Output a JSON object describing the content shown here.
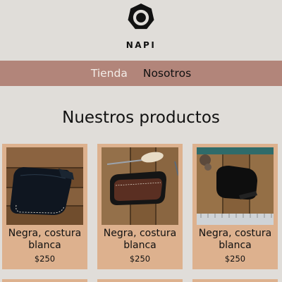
{
  "header": {
    "logo_icon": "heptagon-ring-logo",
    "brand": "NAPI"
  },
  "nav": {
    "items": [
      {
        "label": "Tienda",
        "active": true
      },
      {
        "label": "Nosotros",
        "active": false
      }
    ]
  },
  "main": {
    "title": "Nuestros productos",
    "products": [
      {
        "name": "Negra, costura blanca",
        "price": "$250",
        "photo": "black-leather-wallet-on-wood"
      },
      {
        "name": "Negra, costura blanca",
        "price": "$250",
        "photo": "leather-card-holder-with-awl"
      },
      {
        "name": "Negra, costura blanca",
        "price": "$250",
        "photo": "leather-pouch-with-ruler"
      }
    ]
  },
  "colors": {
    "background": "#e0ddd9",
    "nav": "#b2857a",
    "card": "#ddb18e",
    "active_nav_text": "#f3ede8"
  }
}
